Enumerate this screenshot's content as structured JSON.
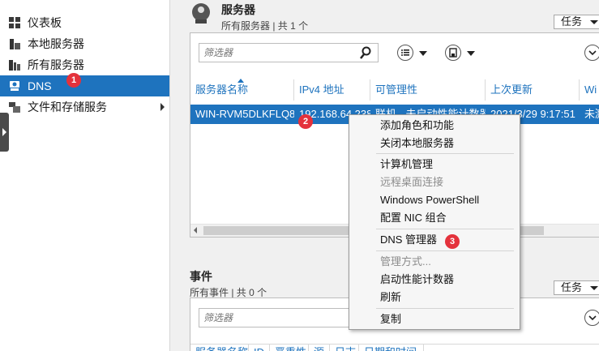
{
  "sidebar": {
    "items": [
      {
        "label": "仪表板"
      },
      {
        "label": "本地服务器"
      },
      {
        "label": "所有服务器"
      },
      {
        "label": "DNS"
      },
      {
        "label": "文件和存储服务"
      }
    ]
  },
  "servers_panel": {
    "title": "服务器",
    "subtitle": "所有服务器 | 共 1 个",
    "tasks_label": "任务",
    "filter_placeholder": "筛选器",
    "columns": [
      "服务器名称",
      "IPv4 地址",
      "可管理性",
      "上次更新",
      "Wi"
    ],
    "rows": [
      {
        "name": "WIN-RVM5DLKFLQ8",
        "ipv4": "192.168.64.238",
        "manageability": "联机 - 未启动性能计数器",
        "last_update": "2021/3/29 9:17:51",
        "extra": "未激"
      }
    ]
  },
  "events_panel": {
    "title": "事件",
    "subtitle": "所有事件 | 共 0 个",
    "tasks_label": "任务",
    "filter_placeholder": "筛选器",
    "columns": [
      "服务器名称",
      "ID",
      "严重性",
      "源",
      "日志",
      "日期和时间"
    ]
  },
  "context_menu": {
    "items": [
      {
        "label": "添加角色和功能",
        "enabled": true
      },
      {
        "label": "关闭本地服务器",
        "enabled": true
      },
      {
        "label": "计算机管理",
        "enabled": true
      },
      {
        "label": "远程桌面连接",
        "enabled": false
      },
      {
        "label": "Windows PowerShell",
        "enabled": true
      },
      {
        "label": "配置 NIC 组合",
        "enabled": true
      },
      {
        "label": "DNS 管理器",
        "enabled": true
      },
      {
        "label": "管理方式...",
        "enabled": false
      },
      {
        "label": "启动性能计数器",
        "enabled": true
      },
      {
        "label": "刷新",
        "enabled": true
      },
      {
        "label": "复制",
        "enabled": true
      }
    ]
  },
  "badges": [
    "1",
    "2",
    "3"
  ],
  "colors": {
    "accent": "#1e73be",
    "badge": "#e4323c"
  }
}
